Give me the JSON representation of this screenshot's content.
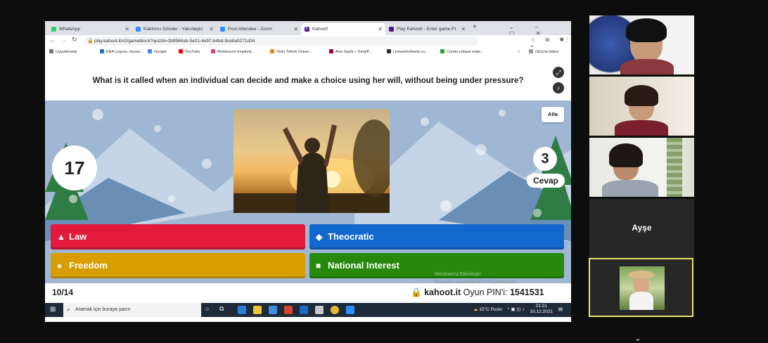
{
  "browser": {
    "tabs": [
      {
        "label": "WhatsApp",
        "color": "#25d366",
        "active": false
      },
      {
        "label": "Katılımcı Gönder - Yakınlaştır",
        "color": "#2d8cff",
        "active": false
      },
      {
        "label": "Post Attendee - Zoom",
        "color": "#2d8cff",
        "active": false
      },
      {
        "label": "Kahoot!",
        "color": "#46178f",
        "active": true
      },
      {
        "label": "Play Kahoot! - Enter game PI",
        "color": "#46178f",
        "active": false
      }
    ],
    "new_tab": "+",
    "url": "play.kahoot.it/v2/gameblock?quizId=2b9564ab-5e01-4e97-b4bd-9ce8a5271d34",
    "bookmarks": [
      {
        "label": "Uygulamalar",
        "color": "#777777"
      },
      {
        "label": "EBA Logosu, beyaz...",
        "color": "#1e73be"
      },
      {
        "label": "Google",
        "color": "#4285f4"
      },
      {
        "label": "YouTube",
        "color": "#ff0000"
      },
      {
        "label": "Montessori Inspired...",
        "color": "#e0407a"
      },
      {
        "label": "Yedu Teknik Üniver...",
        "color": "#e38b1a"
      },
      {
        "label": "Ana Sayfa » DergiP...",
        "color": "#a3002b"
      },
      {
        "label": "Liveworksheets.co...",
        "color": "#333333"
      },
      {
        "label": "Create unique expe...",
        "color": "#2ca02c"
      }
    ],
    "more": "»",
    "reading_list": "Okuma listesi"
  },
  "kahoot": {
    "question": "What is it called when an individual can decide and make a choice using her will, without being under pressure?",
    "skip_label": "Atla",
    "timer": "17",
    "answer_count": "3",
    "answer_label": "Cevap",
    "answers": [
      {
        "label": "Law",
        "shape": "▲",
        "color": "#e21b3c"
      },
      {
        "label": "Theocratic",
        "shape": "◆",
        "color": "#1368ce"
      },
      {
        "label": "Freedom",
        "shape": "●",
        "color": "#d89e00"
      },
      {
        "label": "National Interest",
        "shape": "■",
        "color": "#26890c"
      }
    ],
    "progress": "10/14",
    "site": "kahoot.it",
    "pin_label": "Oyun PIN'i:",
    "pin": "1541531"
  },
  "watermark": {
    "line1": "Windows'u Etkinleştir",
    "line2": "Windows'u etkinleştirmek için Ayarlar'a gidin."
  },
  "taskbar": {
    "search_placeholder": "Aramak için buraya yazın",
    "weather": "15°C Puslu",
    "time": "21:21",
    "date": "10.12.2021"
  },
  "participants": [
    {
      "name": "",
      "speaking": false
    },
    {
      "name": "",
      "speaking": false
    },
    {
      "name": "",
      "speaking": false
    },
    {
      "name": "Ayşe",
      "speaking": false
    },
    {
      "name": "",
      "speaking": true
    }
  ],
  "colors": {
    "speaker_border": "#e8e46a",
    "kahoot_purple": "#46178f"
  }
}
